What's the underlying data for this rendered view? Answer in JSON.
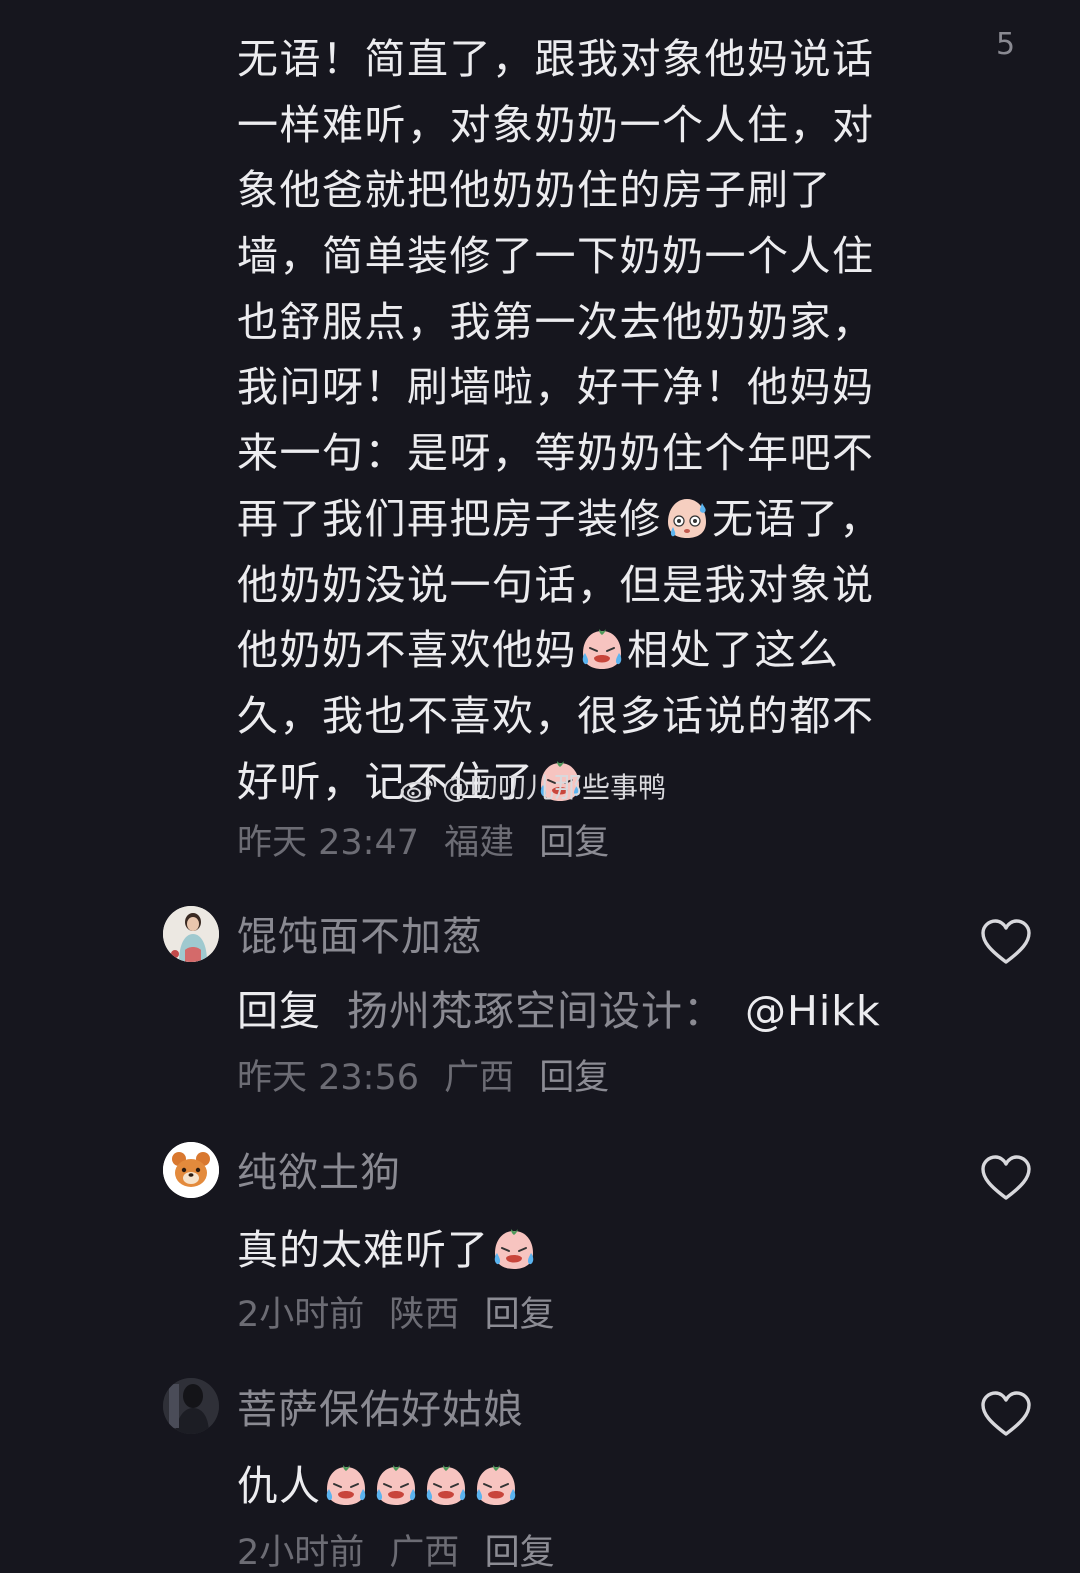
{
  "top_comment": {
    "like_count": "5",
    "lines": [
      "无语！简直了，跟我对象他妈说话",
      "一样难听，对象奶奶一个人住，对",
      "象他爸就把他奶奶住的房子刷了",
      "墙，简单装修了一下奶奶一个人住",
      "也舒服点，我第一次去他奶奶家，",
      "我问呀！刷墙啦，好干净！他妈妈",
      "来一句：是呀，等奶奶住个年吧不",
      "再了我们再把房子装修",
      "无语了，",
      "他奶奶没说一句话，但是我对象说",
      "他奶奶不喜欢他妈",
      "相处了这么",
      "久，我也不喜欢，很多话说的都不",
      "好听，记不住了"
    ],
    "time": "昨天 23:47",
    "location": "福建",
    "reply": "回复"
  },
  "watermark": "@叨叨儿那些事鸭",
  "comments": [
    {
      "username": "馄饨面不加葱",
      "reply_prefix": "回复",
      "reply_target": "扬州梵琢空间设计：",
      "mention": "@Hikk",
      "time": "昨天 23:56",
      "location": "广西",
      "reply": "回复"
    },
    {
      "username": "纯欲土狗",
      "text": "真的太难听了",
      "time": "2小时前",
      "location": "陕西",
      "reply": "回复"
    },
    {
      "username": "菩萨保佑好姑娘",
      "text": "仇人",
      "time": "2小时前",
      "location": "广西",
      "reply": "回复"
    }
  ],
  "icons": {
    "like": "heart-outline-icon",
    "sweat_emoji": "sweat-face-emoji-icon",
    "cry_emoji": "crying-face-emoji-icon",
    "weibo": "weibo-logo-icon"
  }
}
